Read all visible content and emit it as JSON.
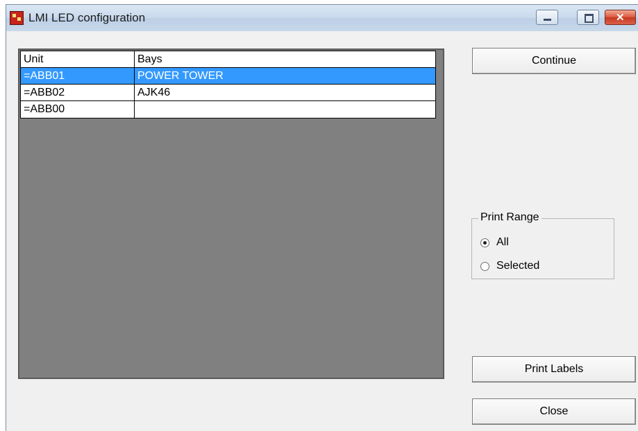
{
  "window": {
    "title": "LMI LED configuration",
    "controls": [
      "minimize-icon",
      "maximize-icon",
      "close-icon"
    ]
  },
  "grid": {
    "columns": [
      "Unit",
      "Bays"
    ],
    "rows": [
      {
        "unit": "=ABB01",
        "bays": "POWER TOWER",
        "selected": true
      },
      {
        "unit": "=ABB02",
        "bays": "AJK46",
        "selected": false
      },
      {
        "unit": "=ABB00",
        "bays": "",
        "selected": false
      }
    ],
    "selection_color": "#3399ff"
  },
  "buttons": {
    "continue": "Continue",
    "print_labels": "Print Labels",
    "close": "Close"
  },
  "print_range": {
    "title": "Print Range",
    "options": [
      {
        "label": "All",
        "checked": true
      },
      {
        "label": "Selected",
        "checked": false
      }
    ]
  }
}
